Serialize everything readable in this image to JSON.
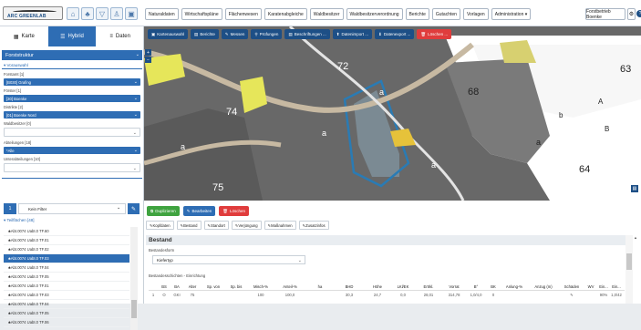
{
  "app": {
    "logo_text": "ARC GREENLAB",
    "forstbetrieb": "Forstbetrieb Boenke"
  },
  "topmenu": [
    "Naturaldaten",
    "Wirtschaftspläne",
    "Flächenwesen",
    "Karatenabgleiche",
    "Waldbesitzer",
    "Waldbesitzerverordnung",
    "Berichte",
    "Gutachten",
    "Vorlagen",
    "Administration ▾"
  ],
  "tabs": [
    {
      "label": "Karte",
      "icon": "map-icon"
    },
    {
      "label": "Hybrid",
      "icon": "hybrid-icon"
    },
    {
      "label": "Daten",
      "icon": "list-icon"
    }
  ],
  "sidebar": {
    "header": "Forststruktur",
    "section": "Vorauswahl",
    "fields": [
      {
        "label": "Forstamt [1]",
        "value": "[B030] Grafing",
        "style": "sel"
      },
      {
        "label": "Förster [1]",
        "value": "[30] Boenke",
        "style": "sel"
      },
      {
        "label": "Distrikte [2]",
        "value": "[01] Boenke Nord",
        "style": "sel"
      },
      {
        "label": "Waldbesitzer [0]",
        "value": "",
        "style": "blank"
      },
      {
        "label": "Abteilungen [18]",
        "value": "*Alle",
        "style": "sel"
      },
      {
        "label": "Unterabteilungen [10]",
        "value": "",
        "style": "blank"
      }
    ],
    "filter": {
      "count": "1",
      "placeholder": "Kein Filter"
    },
    "teilflaechen_label": "Teilflächen [48]",
    "list": [
      "Abt.0074 Uabt.0 TF.60",
      "Abt.0074 Uabt.0 TF.01",
      "Abt.0074 Uabt.0 TF.02",
      "Abt.0074 Uabt.0 TF.03",
      "Abt.0074 Uabt.0 TF.04",
      "Abt.0074 Uabt.0 TF.05",
      "Abt.0074 Uabt.0 TF.01",
      "Abt.0074 Uabt.0 TF.03",
      "Abt.0074 Uabt.0 TF.04",
      "Abt.0074 Uabt.0 TF.05",
      "Abt.0074 Uabt.0 TF.06"
    ],
    "selected_index": 3
  },
  "map": {
    "toolbar": [
      {
        "label": "Kartenauswahl",
        "red": false
      },
      {
        "label": "Berichte",
        "red": false
      },
      {
        "label": "Messen",
        "red": false
      },
      {
        "label": "Prüfungen",
        "red": false
      },
      {
        "label": "Beschriftungen ...",
        "red": false
      },
      {
        "label": "Datenimport ...",
        "red": false
      },
      {
        "label": "Datenexport ...",
        "red": false
      },
      {
        "label": "Löschen ...",
        "red": true
      }
    ],
    "labels": [
      "72",
      "74",
      "75",
      "68",
      "63",
      "64",
      "a",
      "b",
      "A",
      "B"
    ]
  },
  "bottom": {
    "buttons": [
      {
        "label": "Duplizieren",
        "color": "#3fa33f"
      },
      {
        "label": "Bearbeiten",
        "color": "#2e6db4"
      },
      {
        "label": "Löschen",
        "color": "#e03c3c"
      }
    ],
    "subtabs": [
      "Kopfdaten",
      "Bestand",
      "Standort",
      "Verjüngung",
      "Maßnahmen",
      "Zusatzinfos"
    ],
    "title": "Bestand",
    "bestandsform_label": "Bestandesform",
    "bestandsform_value": "Kiefertyp",
    "schichten_label": "Bestandesschichten - Einrichtung",
    "columns": [
      "",
      "BS",
      "BA",
      "Alter",
      "Sp. von",
      "Sp. bis",
      "Misch-%",
      "Anteil-%",
      "ha",
      "BHD",
      "Höhe",
      "LKl/EK",
      "Ertrkl.",
      "Vorrat",
      "B°",
      "BK",
      "Anlung-%",
      "Anzug (m)",
      "Schäden",
      "WV",
      "Ein...",
      "Ein..."
    ],
    "row": [
      "1",
      "O",
      "GKI",
      "75",
      "",
      "",
      "100",
      "100,0",
      "",
      "30,3",
      "24,7",
      "0,0",
      "28,01",
      "314,78",
      "1,0/4,0",
      "0",
      "",
      "",
      "✎",
      "",
      "90%",
      "1,0/42"
    ]
  }
}
